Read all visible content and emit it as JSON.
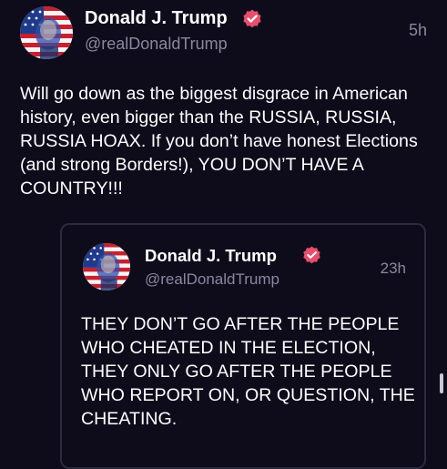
{
  "post": {
    "author": {
      "name": "Donald J. Trump",
      "handle": "@realDonaldTrump",
      "verified": true,
      "avatar_icon": "avatar-flag-portrait"
    },
    "timestamp": "5h",
    "text": "Will go down as the biggest disgrace in American history, even bigger than the RUSSIA, RUSSIA, RUSSIA HOAX. If you don’t have honest Elections (and strong Borders!), YOU DON’T HAVE A COUNTRY!!!"
  },
  "quoted_post": {
    "author": {
      "name": "Donald J. Trump",
      "handle": "@realDonaldTrump",
      "verified": true,
      "avatar_icon": "avatar-flag-portrait"
    },
    "timestamp": "23h",
    "text": "THEY DON’T GO AFTER THE PEOPLE WHO CHEATED IN THE ELECTION, THEY ONLY GO AFTER THE PEOPLE WHO REPORT ON, OR QUESTION, THE CHEATING."
  },
  "colors": {
    "background": "#0e0c1b",
    "text": "#ffffff",
    "muted": "#8b879e",
    "verified_badge": "#e94e6c",
    "quote_border": "#2c2a3d"
  }
}
